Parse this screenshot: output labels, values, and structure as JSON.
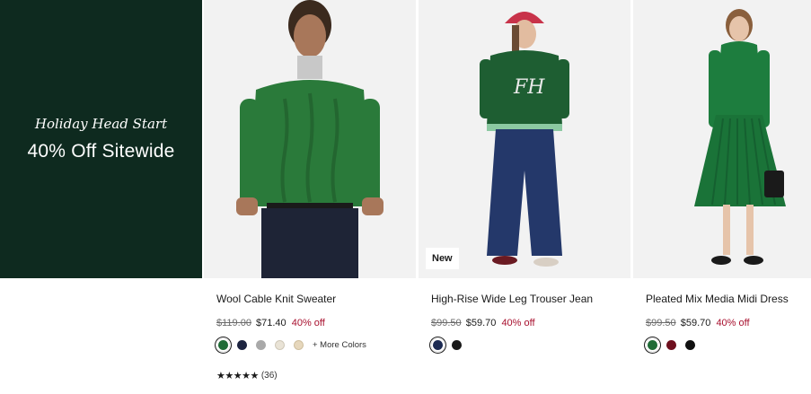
{
  "promo": {
    "eyebrow": "Holiday Head Start",
    "headline": "40% Off Sitewide",
    "bg_color": "#0e2a1f"
  },
  "products": [
    {
      "name": "Wool Cable Knit Sweater",
      "original_price": "$119.00",
      "sale_price": "$71.40",
      "discount": "40% off",
      "badge": "",
      "swatches": [
        {
          "color": "#1f6b36",
          "selected": true
        },
        {
          "color": "#1c2440",
          "selected": false
        },
        {
          "color": "#a9a9a9",
          "selected": false
        },
        {
          "color": "#e9e3d6",
          "selected": false
        },
        {
          "color": "#e6d7bc",
          "selected": false
        }
      ],
      "more_colors": "+ More Colors",
      "rating_stars": "★★★★★",
      "rating_value": 4.5,
      "review_count": "(36)"
    },
    {
      "name": "High-Rise Wide Leg Trouser Jean",
      "original_price": "$99.50",
      "sale_price": "$59.70",
      "discount": "40% off",
      "badge": "New",
      "swatches": [
        {
          "color": "#1c2a52",
          "selected": true
        },
        {
          "color": "#1a1a1a",
          "selected": false
        }
      ]
    },
    {
      "name": "Pleated Mix Media Midi Dress",
      "original_price": "$99.50",
      "sale_price": "$59.70",
      "discount": "40% off",
      "badge": "",
      "swatches": [
        {
          "color": "#1f6b36",
          "selected": true
        },
        {
          "color": "#6e0f1e",
          "selected": false
        },
        {
          "color": "#111111",
          "selected": false
        }
      ]
    }
  ],
  "icons": {
    "badge": "new-badge",
    "rating": "star-rating-icon"
  }
}
